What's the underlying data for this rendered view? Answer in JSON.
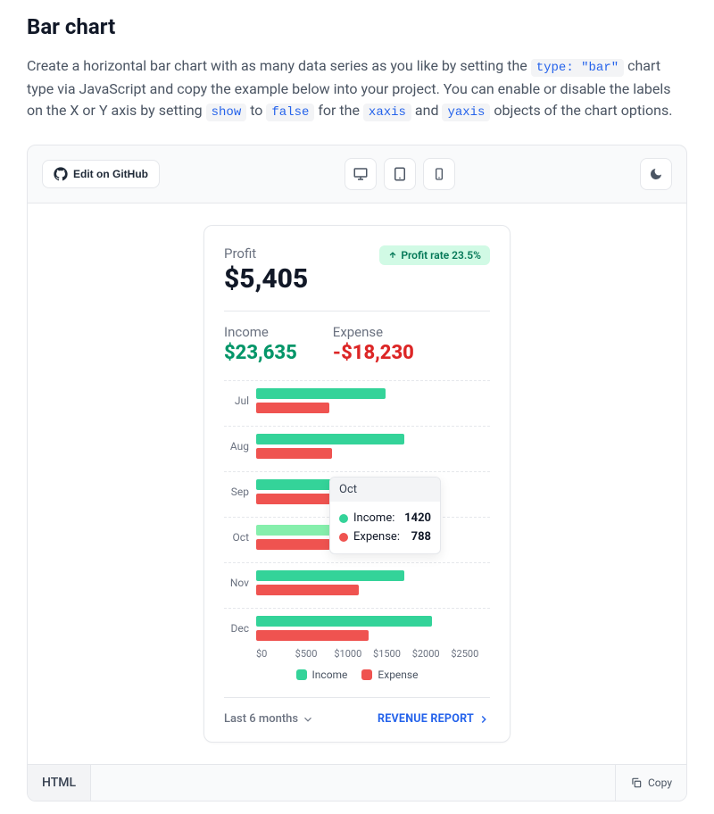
{
  "section": {
    "title": "Bar chart",
    "desc_pre": "Create a horizontal bar chart with as many data series as you like by setting the ",
    "code1": "type: \"bar\"",
    "desc_mid": " chart type via JavaScript and copy the example below into your project. You can enable or disable the labels on the X or Y axis by setting ",
    "code2": "show",
    "desc_mid2": " to ",
    "code3": "false",
    "desc_mid3": " for the ",
    "code4": "xaxis",
    "desc_mid4": " and ",
    "code5": "yaxis",
    "desc_post": " objects of the chart options."
  },
  "toolbar": {
    "edit_label": "Edit on GitHub"
  },
  "card": {
    "profit_label": "Profit",
    "profit_value": "$5,405",
    "badge": "Profit rate 23.5%",
    "income_label": "Income",
    "income_value": "$23,635",
    "expense_label": "Expense",
    "expense_value": "-$18,230",
    "foot_left": "Last 6 months",
    "foot_right": "REVENUE REPORT"
  },
  "legend": {
    "income": "Income",
    "expense": "Expense"
  },
  "xaxis": [
    "$0",
    "$500",
    "$1000",
    "$1500",
    "$2000",
    "$2500"
  ],
  "tooltip": {
    "title": "Oct",
    "s1_label": "Income:",
    "s1_val": "1420",
    "s2_label": "Expense:",
    "s2_val": "788"
  },
  "code_tab": "HTML",
  "copy_label": "Copy",
  "chart_data": {
    "type": "bar",
    "orientation": "horizontal",
    "categories": [
      "Jul",
      "Aug",
      "Sep",
      "Oct",
      "Nov",
      "Dec"
    ],
    "series": [
      {
        "name": "Income",
        "color": "#34d399",
        "values": [
          1380,
          1580,
          1780,
          1420,
          1580,
          1880
        ]
      },
      {
        "name": "Expense",
        "color": "#ef5350",
        "values": [
          780,
          810,
          866,
          788,
          1100,
          1200
        ]
      }
    ],
    "xlabel": "",
    "ylabel": "",
    "xlim": [
      0,
      2500
    ],
    "x_ticks": [
      0,
      500,
      1000,
      1500,
      2000,
      2500
    ],
    "highlighted_category": "Oct",
    "legend_position": "bottom"
  }
}
